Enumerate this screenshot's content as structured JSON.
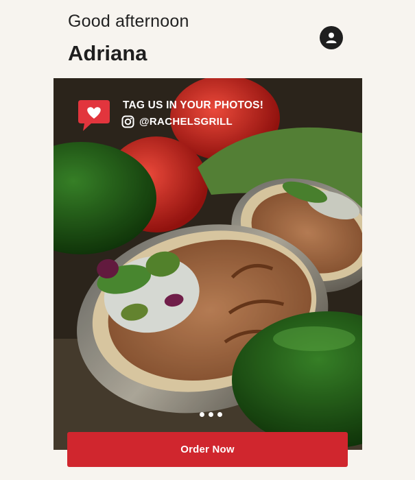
{
  "header": {
    "greeting": "Good afternoon",
    "user_name": "Adriana",
    "account_icon": "user-circle-icon"
  },
  "promo": {
    "title": "TAG US IN YOUR PHOTOS!",
    "handle": "@RACHELSGRILL",
    "speech_icon": "heart-speech-bubble-icon",
    "social_icon": "instagram-icon",
    "carousel_dots": 3
  },
  "cta": {
    "label": "Order Now"
  },
  "colors": {
    "background": "#f7f4ef",
    "accent": "#d0262e",
    "text": "#1f1f1f"
  }
}
